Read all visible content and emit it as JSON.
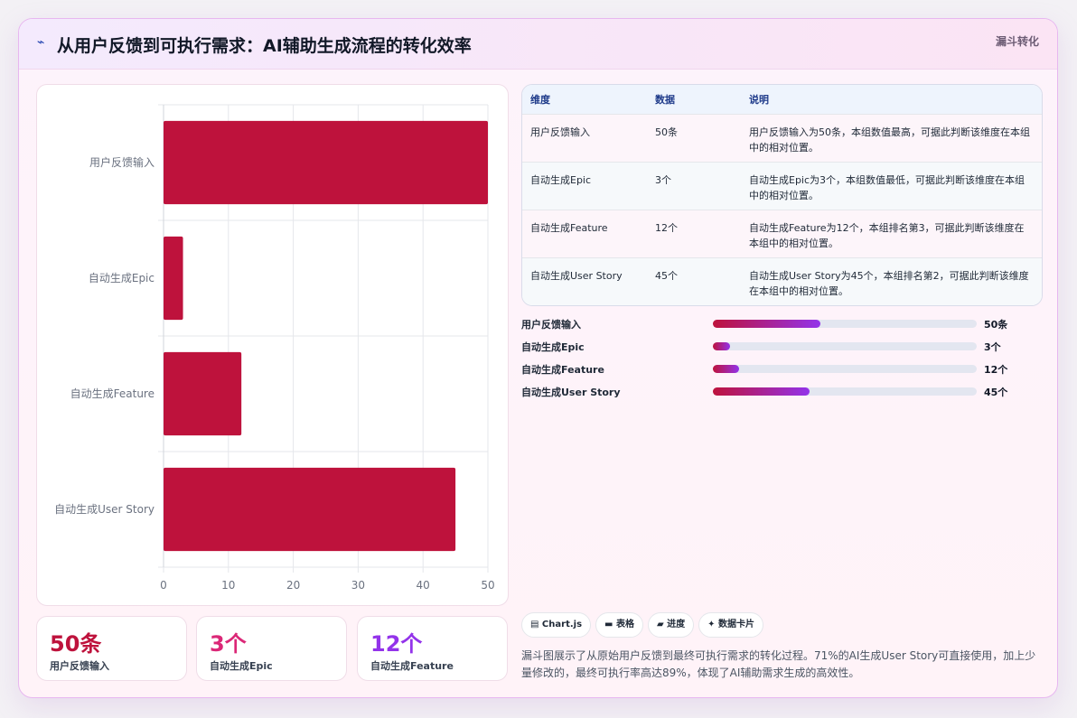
{
  "header": {
    "icon": "⌁",
    "title": "从用户反馈到可执行需求：AI辅助生成流程的转化效率",
    "badge": "漏斗转化"
  },
  "chart_data": {
    "type": "bar",
    "orientation": "horizontal",
    "categories": [
      "用户反馈输入",
      "自动生成Epic",
      "自动生成Feature",
      "自动生成User Story"
    ],
    "values": [
      50,
      3,
      12,
      45
    ],
    "xlim": [
      0,
      50
    ],
    "xticks": [
      0,
      10,
      20,
      30,
      40,
      50
    ],
    "grid": true,
    "color": "#be123c"
  },
  "table": {
    "headers": [
      "维度",
      "数据",
      "说明"
    ],
    "rows": [
      [
        "用户反馈输入",
        "50条",
        "用户反馈输入为50条，本组数值最高，可据此判断该维度在本组中的相对位置。"
      ],
      [
        "自动生成Epic",
        "3个",
        "自动生成Epic为3个，本组数值最低，可据此判断该维度在本组中的相对位置。"
      ],
      [
        "自动生成Feature",
        "12个",
        "自动生成Feature为12个，本组排名第3，可据此判断该维度在本组中的相对位置。"
      ],
      [
        "自动生成User Story",
        "45个",
        "自动生成User Story为45个，本组排名第2，可据此判断该维度在本组中的相对位置。"
      ]
    ]
  },
  "progress": [
    {
      "label": "用户反馈输入",
      "value": "50条",
      "fraction": 0.407
    },
    {
      "label": "自动生成Epic",
      "value": "3个",
      "fraction": 0.065
    },
    {
      "label": "自动生成Feature",
      "value": "12个",
      "fraction": 0.098
    },
    {
      "label": "自动生成User Story",
      "value": "45个",
      "fraction": 0.366
    }
  ],
  "stats": [
    {
      "value": "50条",
      "caption": "用户反馈输入",
      "color": "#be123c"
    },
    {
      "value": "3个",
      "caption": "自动生成Epic",
      "color": "#db2777"
    },
    {
      "value": "12个",
      "caption": "自动生成Feature",
      "color": "#9333ea"
    }
  ],
  "tags": [
    "▤ Chart.js",
    "▬ 表格",
    "▰ 进度",
    "✦ 数据卡片"
  ],
  "summary": "漏斗图展示了从原始用户反馈到最终可执行需求的转化过程。71%的AI生成User Story可直接使用，加上少量修改的，最终可执行率高达89%，体现了AI辅助需求生成的高效性。"
}
